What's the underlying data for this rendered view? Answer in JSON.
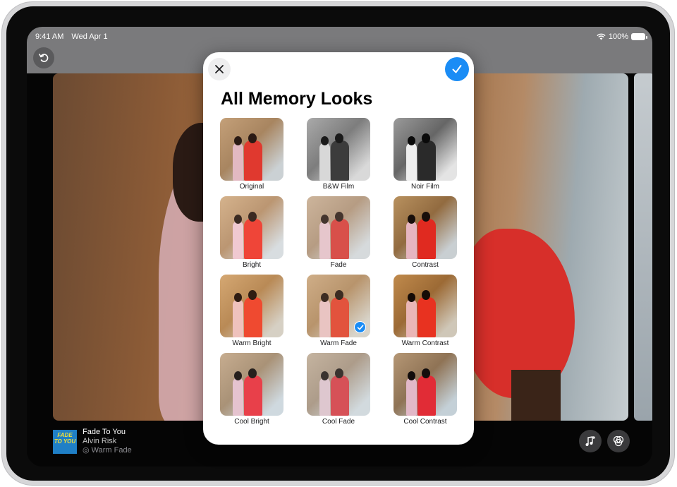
{
  "status_bar": {
    "time": "9:41 AM",
    "date": "Wed Apr 1",
    "battery": "100%"
  },
  "nav": {
    "title": "Memory Looks"
  },
  "sheet": {
    "title": "All Memory Looks",
    "accent_color": "#1a8cf5",
    "looks": [
      {
        "name": "Original",
        "tone": "color"
      },
      {
        "name": "B&W Film",
        "tone": "bw"
      },
      {
        "name": "Noir Film",
        "tone": "noir"
      },
      {
        "name": "Bright",
        "tone": "bright"
      },
      {
        "name": "Fade",
        "tone": "fade"
      },
      {
        "name": "Contrast",
        "tone": "contrast"
      },
      {
        "name": "Warm Bright",
        "tone": "warm"
      },
      {
        "name": "Warm Fade",
        "tone": "warmfade",
        "selected": true
      },
      {
        "name": "Warm Contrast",
        "tone": "warmcontrast"
      },
      {
        "name": "Cool Bright",
        "tone": "cool"
      },
      {
        "name": "Cool Fade",
        "tone": "coolfade"
      },
      {
        "name": "Cool Contrast",
        "tone": "coolcontrast"
      }
    ]
  },
  "now_playing": {
    "artwork_text": "FADE TO YOU",
    "song": "Fade To You",
    "artist": "Alvin Risk",
    "look": "Warm Fade"
  },
  "icons": {
    "undo": "rotate-ccw-icon",
    "close": "xmark-icon",
    "done": "checkmark-icon",
    "music": "music-note-plus-icon",
    "looks": "memory-looks-icon"
  }
}
